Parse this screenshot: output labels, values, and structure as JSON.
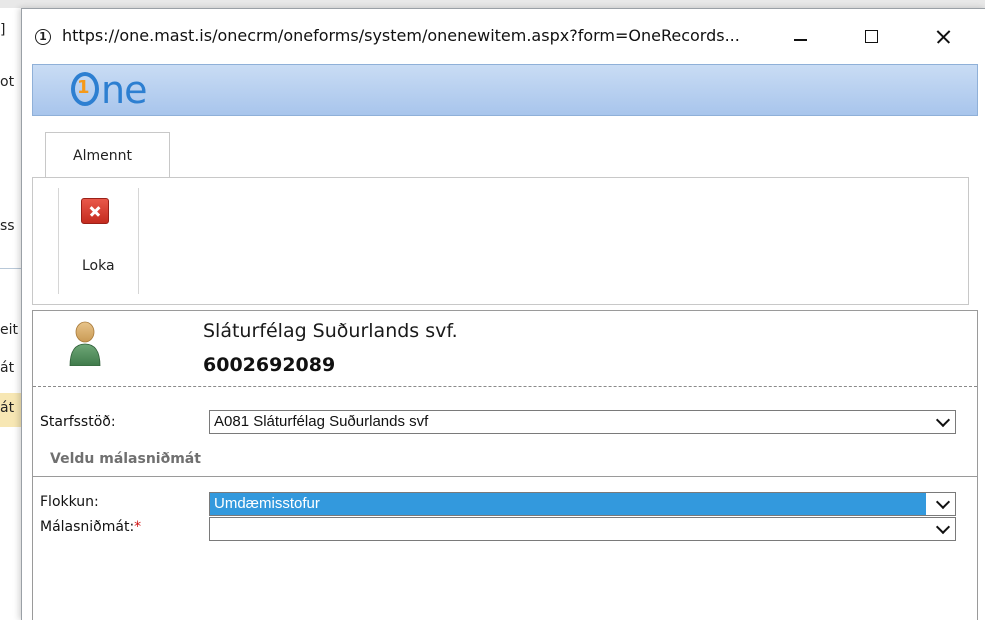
{
  "background": {
    "fragments": [
      "]",
      "ot",
      "ss",
      "eit",
      "át",
      "át"
    ]
  },
  "window": {
    "url": "https://one.mast.is/onecrm/oneforms/system/onenewitem.aspx?form=OneRecords...",
    "site_icon_glyph": "1"
  },
  "header": {
    "logo_mark": "1",
    "logo_text": "ne"
  },
  "ribbon": {
    "tabs": [
      {
        "label": "Almennt"
      }
    ],
    "buttons": [
      {
        "label": "Loka",
        "icon": "close-icon"
      }
    ]
  },
  "record": {
    "name": "Sláturfélag Suðurlands svf.",
    "id": "6002692089",
    "avatar_icon": "person-icon"
  },
  "form": {
    "workplace": {
      "label": "Starfsstöð:",
      "value": "A081 Sláturfélag Suðurlands svf"
    },
    "section_title": "Veldu málasniðmát",
    "category": {
      "label": "Flokkun:",
      "value": "Umdæmisstofur"
    },
    "template": {
      "label": "Málasniðmát:",
      "required_marker": "*",
      "value": ""
    }
  },
  "colors": {
    "accent": "#2d7fd1",
    "selected": "#3399dd",
    "required": "#d01010",
    "header_bg": "#b7d0f0"
  }
}
